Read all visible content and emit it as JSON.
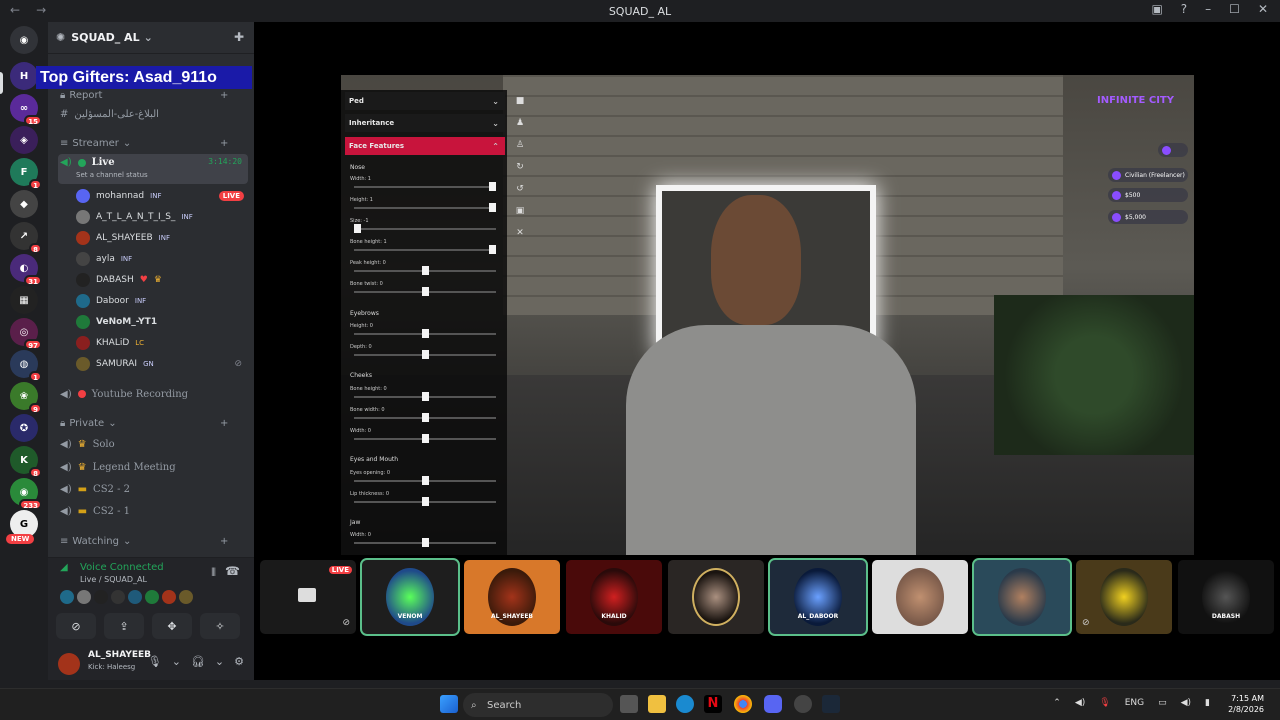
{
  "window": {
    "title": "SQUAD_ AL"
  },
  "server": {
    "name": "SQUAD_ AL"
  },
  "banner": {
    "text": "Top Gifters: Asad_911o"
  },
  "sidebar": {
    "categories": [
      {
        "label": "Report"
      },
      {
        "label": "Streamer"
      },
      {
        "label": "Private"
      },
      {
        "label": "Watching"
      }
    ],
    "report_channel": "البلاغ-على-المسؤلين",
    "live_channel": {
      "name": "Live",
      "time": "3:14:20",
      "status": "Set a channel status"
    },
    "members": [
      {
        "name": "mohannad",
        "tag": "INF",
        "live": "LIVE"
      },
      {
        "name": "A_T_L_A_N_T_I_S_",
        "tag": "INF"
      },
      {
        "name": "AL_SHAYEEB",
        "tag": "INF"
      },
      {
        "name": "ayla",
        "tag": "INF"
      },
      {
        "name": "DABASH",
        "tag": ""
      },
      {
        "name": "Daboor",
        "tag": "INF"
      },
      {
        "name": "VeNoM_-YT1",
        "tag": ""
      },
      {
        "name": "KHALiD",
        "tag": "LC"
      },
      {
        "name": "SAMURAI",
        "tag": "GN"
      }
    ],
    "voice_channels": [
      {
        "name": "Youtube Recording"
      },
      {
        "name": "Solo"
      },
      {
        "name": "Legend Meeting"
      },
      {
        "name": "CS2 - 2"
      },
      {
        "name": "CS2 - 1"
      }
    ]
  },
  "voice": {
    "status": "Voice Connected",
    "location": "Live / SQUAD_AL"
  },
  "user": {
    "name": "AL_SHAYEEB",
    "status": "Kick: Haleesg"
  },
  "rail_badges": [
    "15",
    "1",
    "8",
    "31",
    "97",
    "1",
    "9",
    "8",
    "233",
    "NEW"
  ],
  "game": {
    "panel_tabs": [
      "Ped",
      "Inheritance",
      "Face Features"
    ],
    "sections": [
      "Nose",
      "Eyebrows",
      "Cheeks",
      "Eyes and Mouth",
      "Jaw"
    ],
    "sliders": [
      {
        "label": "Width: 1",
        "value": 1.0
      },
      {
        "label": "Height: 1",
        "value": 1.0
      },
      {
        "label": "Size: -1",
        "value": 0.0
      },
      {
        "label": "Bone height: 1",
        "value": 1.0
      },
      {
        "label": "Peak height: 0",
        "value": 0.5
      },
      {
        "label": "Bone twist: 0",
        "value": 0.5
      },
      {
        "label": "Height: 0",
        "value": 0.5
      },
      {
        "label": "Depth: 0",
        "value": 0.5
      },
      {
        "label": "Bone height: 0",
        "value": 0.5
      },
      {
        "label": "Bone width: 0",
        "value": 0.5
      },
      {
        "label": "Width: 0",
        "value": 0.5
      },
      {
        "label": "Eyes opening: 0",
        "value": 0.5
      },
      {
        "label": "Lip thickness: 0",
        "value": 0.5
      },
      {
        "label": "Width: 0",
        "value": 0.5
      }
    ],
    "logo": "INFINITE CITY",
    "hud": [
      {
        "text": "Civilian (Freelancer)"
      },
      {
        "text": "$500"
      },
      {
        "text": "$5,000"
      }
    ]
  },
  "tiles": [
    {
      "label": "",
      "live": "LIVE"
    },
    {
      "label": "VENOM"
    },
    {
      "label": "AL_SHAYEEB"
    },
    {
      "label": "KHALID"
    },
    {
      "label": ""
    },
    {
      "label": "AL_DABOOR"
    },
    {
      "label": ""
    },
    {
      "label": ""
    },
    {
      "label": ""
    },
    {
      "label": "DABASH"
    }
  ],
  "taskbar": {
    "search": "Search",
    "lang": "ENG",
    "time": "7:15 AM",
    "date": "2/8/2026"
  },
  "colors": {
    "accent": "#c8143c",
    "discord_bg": "#2b2d31",
    "live": "#f23f43",
    "online": "#23a55a"
  }
}
